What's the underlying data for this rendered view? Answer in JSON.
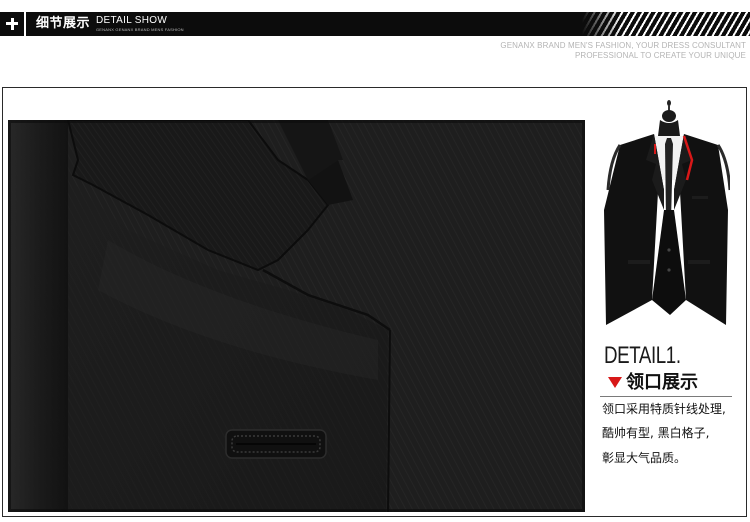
{
  "header": {
    "title_cn": "细节展示",
    "title_en": "DETAIL SHOW",
    "subtitle_en": "GENANX GENANX BRAND MENS FASHION"
  },
  "tagline": {
    "line1": "GENANX BRAND MEN'S FASHION, YOUR DRESS CONSULTANT",
    "line2": "PROFESSIONAL TO CREATE YOUR UNIQUE"
  },
  "detail": {
    "label": "DETAIL1.",
    "title": "领口展示",
    "description": [
      "领口采用特质针线处理,",
      "酷帅有型, 黑白格子,",
      "彰显大气品质。"
    ]
  },
  "colors": {
    "header_bg": "#0c0c0c",
    "accent_red": "#d81818",
    "fabric_dark": "#1c1c1c"
  },
  "icons": {
    "plus": "plus-icon",
    "marker": "triangle-down-icon"
  }
}
